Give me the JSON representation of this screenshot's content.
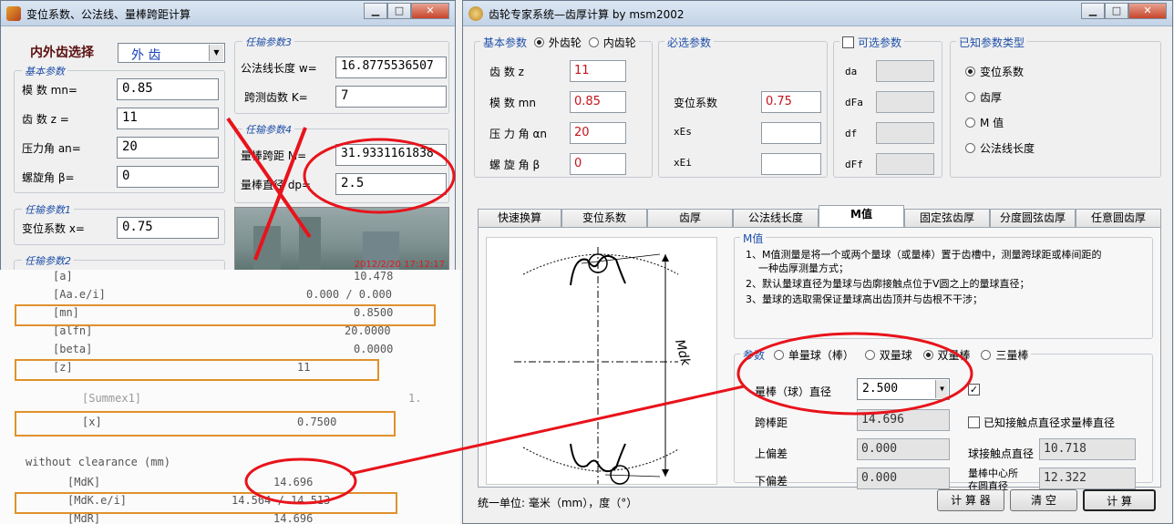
{
  "left_window": {
    "title": "变位系数、公法线、量棒跨距计算",
    "gear_select_label": "内外齿选择",
    "gear_select_value": "外  齿",
    "basic_params": {
      "title": "基本参数",
      "mn_label": "模  数 mn=",
      "mn_value": "0.85",
      "z_label": "齿  数 z =",
      "z_value": "11",
      "an_label": "压力角 an=",
      "an_value": "20",
      "beta_label": "螺旋角 β=",
      "beta_value": "0"
    },
    "param1": {
      "title": "任输参数1",
      "x_label": "变位系数 x=",
      "x_value": "0.75"
    },
    "param2": {
      "title": "任输参数2"
    },
    "param3": {
      "title": "任输参数3",
      "w_label": "公法线长度 w=",
      "w_value": "16.8775536507",
      "k_label": "跨测齿数 K=",
      "k_value": "7"
    },
    "param4": {
      "title": "任输参数4",
      "m_label": "量棒跨距 M=",
      "m_value": "31.9331161838",
      "dp_label": "量棒直径 dp=",
      "dp_value": "2.5"
    },
    "photo_timestamp": "2012/2/20 17:12:17"
  },
  "printout": {
    "rows": [
      {
        "key": "[a]",
        "value": "10.478"
      },
      {
        "key": "[Aa.e/i]",
        "value": "0.000 / 0.000"
      },
      {
        "key": "[mn]",
        "value": "0.8500"
      },
      {
        "key": "[alfn]",
        "value": "20.0000"
      },
      {
        "key": "[beta]",
        "value": "0.0000"
      },
      {
        "key": "[z]",
        "value": "11"
      },
      {
        "key": "[Summex1]",
        "value": "1."
      },
      {
        "key": "[x]",
        "value": "0.7500"
      },
      {
        "key": "without clearance (mm)",
        "value": ""
      },
      {
        "key": "[MdK]",
        "value": "14.696"
      },
      {
        "key": "[MdK.e/i]",
        "value": "14.564 / 14.513"
      },
      {
        "key": "[MdR]",
        "value": "14.696"
      }
    ]
  },
  "right_window": {
    "title": "齿轮专家系统—齿厚计算 by msm2002",
    "basic": {
      "title": "基本参数",
      "radio_external": "外齿轮",
      "radio_internal": "内齿轮",
      "z_label": "齿   数 z",
      "z_value": "11",
      "mn_label": "模   数 mn",
      "mn_value": "0.85",
      "an_label": "压 力 角 αn",
      "an_value": "20",
      "beta_label": "螺 旋 角 β",
      "beta_value": "0"
    },
    "required": {
      "title": "必选参数",
      "x_label": "变位系数",
      "x_value": "0.75",
      "xEs_label": "xEs",
      "xEi_label": "xEi"
    },
    "optional": {
      "title": "可选参数",
      "da": "da",
      "dFa": "dFa",
      "df": "df",
      "dFf": "dFf"
    },
    "known_type": {
      "title": "已知参数类型",
      "options": [
        "变位系数",
        "齿厚",
        "M 值",
        "公法线长度"
      ]
    },
    "tabs": [
      "快速换算",
      "变位系数",
      "齿厚",
      "公法线长度",
      "M值",
      "固定弦齿厚",
      "分度圆弦齿厚",
      "任意圆齿厚"
    ],
    "m_info": {
      "title": "M值",
      "line1": "1、M值测量是将一个或两个量球（或量棒）置于齿槽中，测量跨球距或棒间距的",
      "line1b": "一种齿厚测量方式；",
      "line2": "2、默认量球直径为量球与齿廓接触点位于V圆之上的量球直径；",
      "line3": "3、量球的选取需保证量球高出齿顶并与齿根不干涉；"
    },
    "diagram_label": "Mdk",
    "params": {
      "title": "参数",
      "radios": [
        "单量球（棒）",
        "双量球",
        "双量棒",
        "三量棒"
      ],
      "dia_label": "量棒（球）直径",
      "dia_value": "2.500",
      "span_label": "跨棒距",
      "span_value": "14.696",
      "upper_label": "上偏差",
      "upper_value": "0.000",
      "lower_label": "下偏差",
      "lower_value": "0.000",
      "known_contact_label": "已知接触点直径求量棒直径",
      "contact_dia_label": "球接触点直径",
      "contact_dia_value": "10.718",
      "center_label_1": "量棒中心所",
      "center_label_2": "在圆直径",
      "center_value": "12.322"
    },
    "units_label": "统一单位:  毫米（mm），度（°）",
    "btn_calc": "计 算 器",
    "btn_clear": "清   空",
    "btn_compute": "计   算"
  },
  "colors": {
    "annotation": "#e8131b",
    "highlight_box": "#e0912c",
    "group_title": "#1f4fa8",
    "value_red": "#c4141b"
  }
}
